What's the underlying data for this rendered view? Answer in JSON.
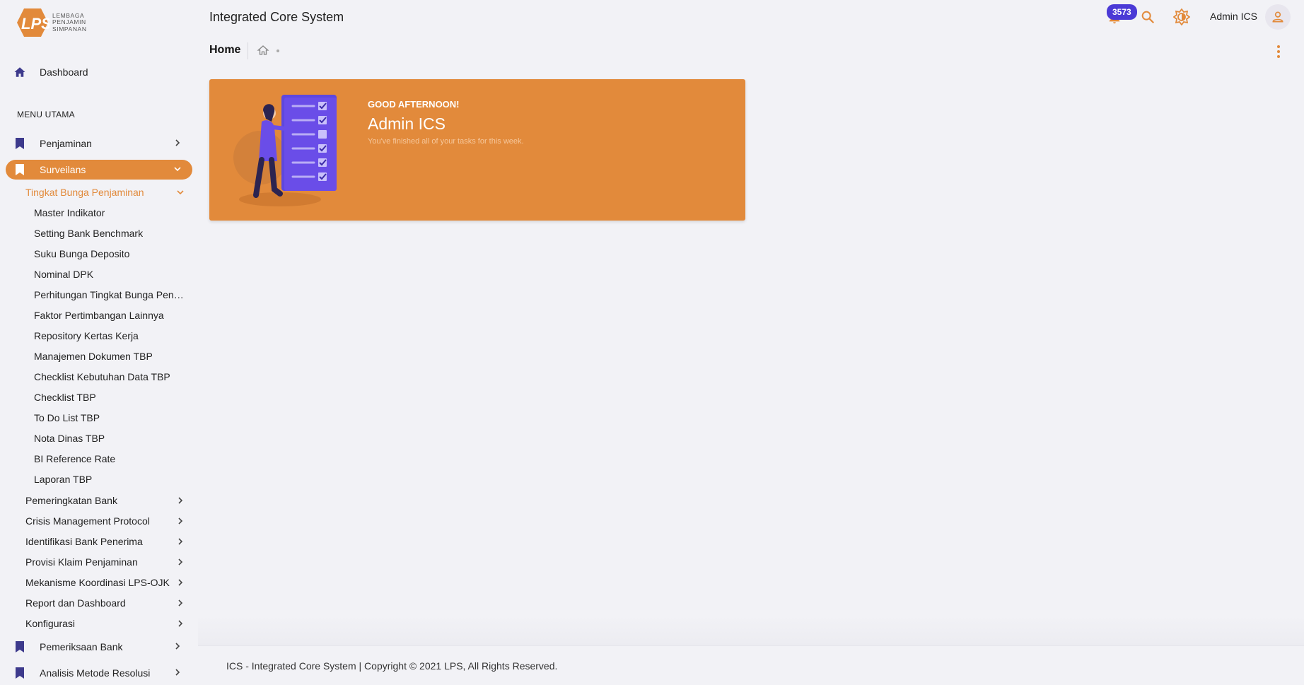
{
  "logo": {
    "lines": [
      "LEMBAGA",
      "PENJAMIN",
      "SIMPANAN"
    ]
  },
  "header": {
    "app_title": "Integrated Core System",
    "notification_count": "3573",
    "user_name": "Admin ICS"
  },
  "sidebar": {
    "dashboard": "Dashboard",
    "section_title": "MENU UTAMA",
    "penjaminan": "Penjaminan",
    "surveilans": "Surveilans",
    "sub_header": "Tingkat Bunga Penjaminan",
    "leaves": [
      "Master Indikator",
      "Setting Bank Benchmark",
      "Suku Bunga Deposito",
      "Nominal DPK",
      "Perhitungan Tingkat Bunga Penjaminan",
      "Faktor Pertimbangan Lainnya",
      "Repository Kertas Kerja",
      "Manajemen Dokumen TBP",
      "Checklist Kebutuhan Data TBP",
      "Checklist TBP",
      "To Do List TBP",
      "Nota Dinas TBP",
      "BI Reference Rate",
      "Laporan TBP"
    ],
    "groups": [
      "Pemeringkatan Bank",
      "Crisis Management Protocol",
      "Identifikasi Bank Penerima",
      "Provisi Klaim Penjaminan",
      "Mekanisme Koordinasi LPS-OJK",
      "Report dan Dashboard",
      "Konfigurasi"
    ],
    "pemeriksaan": "Pemeriksaan Bank",
    "analisis": "Analisis Metode Resolusi"
  },
  "breadcrumb": {
    "title": "Home"
  },
  "card": {
    "greeting": "GOOD AFTERNOON!",
    "name": "Admin ICS",
    "subtitle": "You've finished all of your tasks for this week."
  },
  "footer": {
    "text": "ICS - Integrated Core System | Copyright © 2021 LPS, All Rights Reserved."
  },
  "colors": {
    "accent": "#e28a3b",
    "badge": "#4b3ad6",
    "illustration": "#6a4de8"
  }
}
